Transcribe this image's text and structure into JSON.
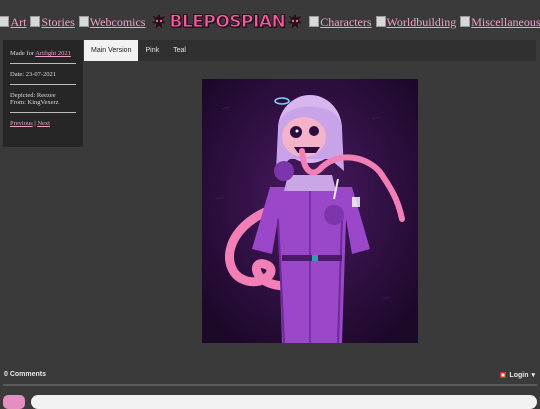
{
  "nav": {
    "left": [
      {
        "label": "Art"
      },
      {
        "label": "Stories"
      },
      {
        "label": "Webcomics"
      }
    ],
    "logo_text": "BLEPOSPIAN",
    "right": [
      {
        "label": "Characters"
      },
      {
        "label": "Worldbuilding"
      },
      {
        "label": "Miscellaneous"
      }
    ]
  },
  "sidebar": {
    "made_for_prefix": "Made for ",
    "made_for_link": "Artfight 2021",
    "date": "Date: 23-07-2021",
    "depicted": "Depicted: Reezee",
    "from": "From: KingVexerz",
    "previous": "Previous",
    "separator": " | ",
    "next": "Next"
  },
  "tabs": [
    {
      "label": "Main Version",
      "active": true
    },
    {
      "label": "Pink",
      "active": false
    },
    {
      "label": "Teal",
      "active": false
    }
  ],
  "comments": {
    "count_label": "0 Comments",
    "login_label": "Login",
    "login_caret": "▾"
  },
  "colors": {
    "background": "#3a3a3a",
    "link": "#f0a0c8",
    "logo": "#ff5da2",
    "artwork_bg": "#2a0d3e",
    "character_suit": "#9b47c9",
    "tongue": "#f27fb6"
  }
}
